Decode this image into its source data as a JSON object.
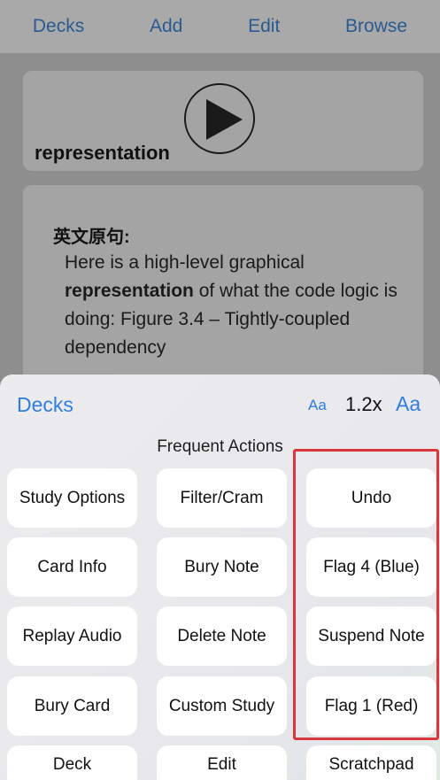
{
  "topbar": {
    "decks": "Decks",
    "add": "Add",
    "edit": "Edit",
    "browse": "Browse"
  },
  "card": {
    "word": "representation",
    "play_icon": "play-icon",
    "heading": "英文原句:",
    "sentence_before": " Here is a high-level graphical ",
    "sentence_bold": "representation",
    "sentence_after": " of what the code logic is doing: Figure 3.4 – Tightly-coupled dependency"
  },
  "sheet": {
    "decks_label": "Decks",
    "font_small": "Aa",
    "zoom": "1.2x",
    "font_large": "Aa",
    "section_title": "Frequent Actions",
    "buttons": [
      [
        "Study Options",
        "Filter/Cram",
        "Undo"
      ],
      [
        "Card Info",
        "Bury Note",
        "Flag 4 (Blue)"
      ],
      [
        "Replay Audio",
        "Delete Note",
        "Suspend Note"
      ],
      [
        "Bury Card",
        "Custom Study",
        "Flag 1 (Red)"
      ],
      [
        "Deck",
        "Edit",
        "Scratchpad"
      ]
    ]
  },
  "colors": {
    "accent": "#2e7de0",
    "highlight": "#d9363e"
  }
}
